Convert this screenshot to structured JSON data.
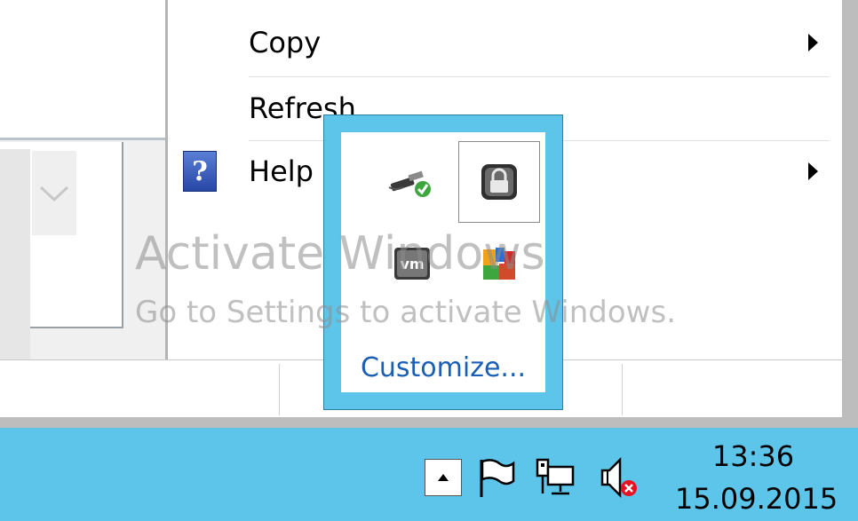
{
  "context_menu": {
    "items": [
      {
        "label": "Copy",
        "has_submenu": true
      },
      {
        "label": "Refresh",
        "has_submenu": false
      },
      {
        "label": "Help",
        "has_submenu": true,
        "icon": "help-icon"
      }
    ]
  },
  "watermark": {
    "title": "Activate Windows",
    "subtitle": "Go to Settings to activate Windows."
  },
  "tray_overflow": {
    "icons": [
      {
        "name": "safely-remove-hardware-icon"
      },
      {
        "name": "lock-icon",
        "hovered": true
      },
      {
        "name": "vmware-tools-icon"
      },
      {
        "name": "avg-antivirus-icon"
      }
    ],
    "customize_label": "Customize..."
  },
  "taskbar": {
    "system_tray": [
      {
        "name": "show-hidden-icons-button"
      },
      {
        "name": "action-center-flag-icon"
      },
      {
        "name": "network-icon"
      },
      {
        "name": "volume-muted-icon"
      }
    ],
    "clock": {
      "time": "13:36",
      "date": "15.09.2015"
    }
  },
  "colors": {
    "taskbar_bg": "#5ec5ea",
    "link": "#1a5fb4",
    "watermark": "#8c8c8c"
  }
}
